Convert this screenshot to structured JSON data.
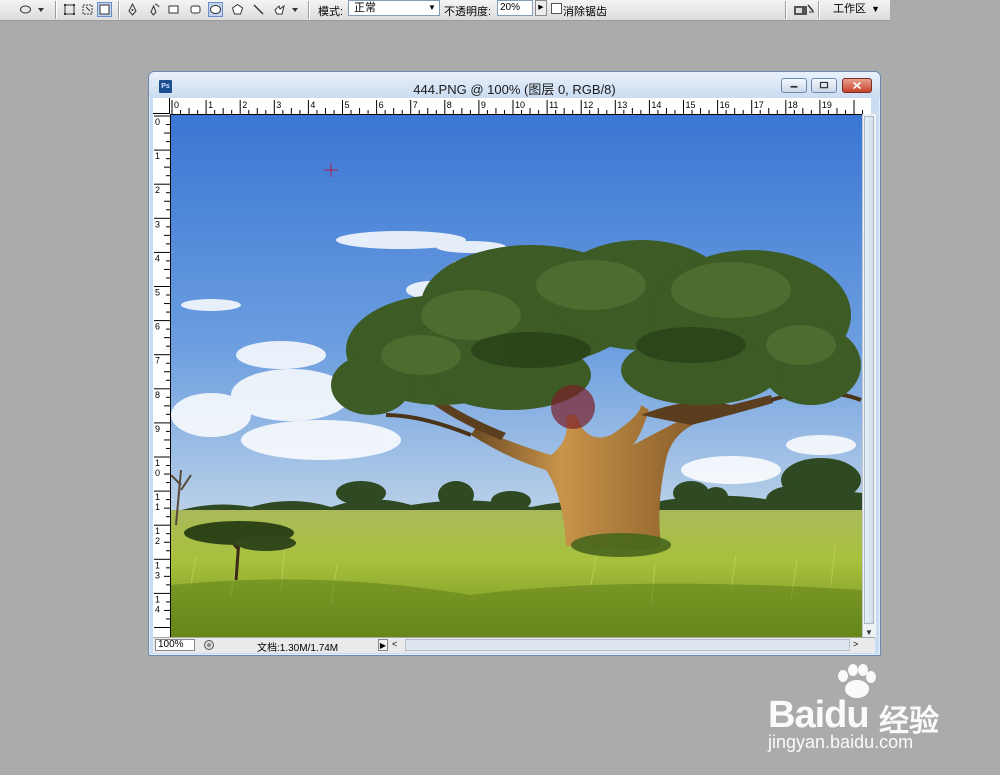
{
  "options_bar": {
    "mode_label": "模式:",
    "mode_value": "正常",
    "opacity_label": "不透明度:",
    "opacity_value": "20%",
    "antialias_label": "消除锯齿",
    "antialias_checked": false,
    "workspace_label": "工作区"
  },
  "document": {
    "title": "444.PNG @ 100% (图层 0, RGB/8)",
    "ruler_top_numbers": [
      "0",
      "1",
      "2",
      "3",
      "4",
      "5",
      "6",
      "7",
      "8",
      "9",
      "10",
      "11",
      "12",
      "13",
      "14",
      "15",
      "16",
      "17",
      "18",
      "19"
    ],
    "ruler_left_numbers": [
      "0",
      "1",
      "2",
      "3",
      "4",
      "5",
      "6",
      "7",
      "8",
      "9",
      "10",
      "11",
      "12",
      "13",
      "14"
    ],
    "zoom": "100%",
    "doc_info": "文档:1.30M/1.74M"
  },
  "watermark": {
    "brand": "Baidu",
    "brand_cn": "经验",
    "url": "jingyan.baidu.com"
  },
  "colors": {
    "workspace_bg": "#ababab",
    "window_frame": "#c9dcf2",
    "sky_top": "#3d78d2",
    "grass": "#9bb53a"
  }
}
